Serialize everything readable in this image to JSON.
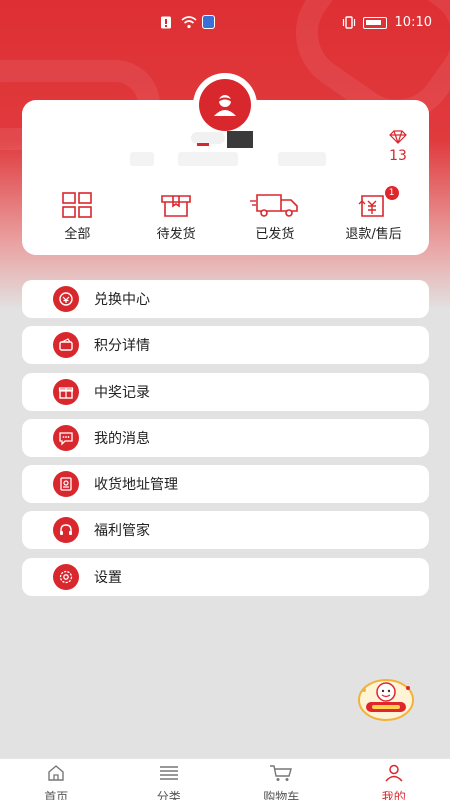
{
  "status_bar": {
    "time": "10:10",
    "icons": [
      "notification-icon",
      "wifi-icon",
      "vpn-shield-icon",
      "vibrate-icon",
      "battery-icon"
    ]
  },
  "profile": {
    "avatar_icon": "user-avatar-icon",
    "points_icon": "diamond-icon",
    "points_value": "13"
  },
  "orders": [
    {
      "label": "全部",
      "icon": "grid-icon"
    },
    {
      "label": "待发货",
      "icon": "package-icon"
    },
    {
      "label": "已发货",
      "icon": "truck-icon"
    },
    {
      "label": "退款/售后",
      "icon": "refund-icon",
      "badge": "1"
    }
  ],
  "menu": [
    {
      "label": "兑换中心",
      "icon": "exchange-icon"
    },
    {
      "label": "积分详情",
      "icon": "wallet-icon"
    },
    {
      "label": "中奖记录",
      "icon": "gift-icon"
    },
    {
      "label": "我的消息",
      "icon": "message-icon"
    },
    {
      "label": "收货地址管理",
      "icon": "address-icon"
    },
    {
      "label": "福利管家",
      "icon": "headset-icon"
    },
    {
      "label": "设置",
      "icon": "settings-icon"
    }
  ],
  "tabbar": [
    {
      "label": "首页",
      "icon": "home-icon",
      "active": false
    },
    {
      "label": "分类",
      "icon": "list-icon",
      "active": false
    },
    {
      "label": "购物车",
      "icon": "cart-icon",
      "active": false
    },
    {
      "label": "我的",
      "icon": "user-icon",
      "active": true
    }
  ],
  "colors": {
    "accent": "#d9272e",
    "header": "#de2f34",
    "background": "#e2e2e2"
  }
}
